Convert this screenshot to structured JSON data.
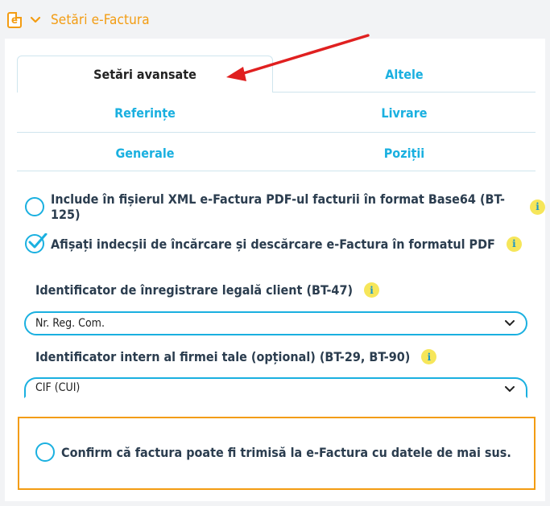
{
  "header": {
    "logo_icon": "efactura-logo-icon",
    "collapse_icon": "chevron-down-icon",
    "title": "Setări e-Factura",
    "accent_color": "#f39c12"
  },
  "tabs": {
    "row1": [
      {
        "label": "Setări avansate",
        "active": true
      },
      {
        "label": "Altele",
        "active": false
      }
    ],
    "row2": [
      {
        "label": "Referințe",
        "active": false
      },
      {
        "label": "Livrare",
        "active": false
      }
    ],
    "row3": [
      {
        "label": "Generale",
        "active": false
      },
      {
        "label": "Poziții",
        "active": false
      }
    ],
    "link_color": "#1ab0e0"
  },
  "options": [
    {
      "label": "Include în fișierul XML e-Factura PDF-ul facturii în format Base64 (BT-125)",
      "checked": false
    },
    {
      "label": "Afișați indecșii de încărcare și descărcare e-Factura în formatul PDF",
      "checked": true
    }
  ],
  "fields": [
    {
      "label": "Identificator de înregistrare legală client (BT-47)",
      "value": "Nr. Reg. Com."
    },
    {
      "label": "Identificator intern al firmei tale (opțional) (BT-29, BT-90)",
      "value": "CIF (CUI)"
    }
  ],
  "info_icon": {
    "glyph": "i",
    "color": "#f6e65a"
  },
  "confirm": {
    "label": "Confirm că factura poate fi trimisă la e-Factura cu datele de mai sus.",
    "checked": false
  },
  "annotation": {
    "icon": "red-arrow-icon",
    "color": "#e02020"
  }
}
